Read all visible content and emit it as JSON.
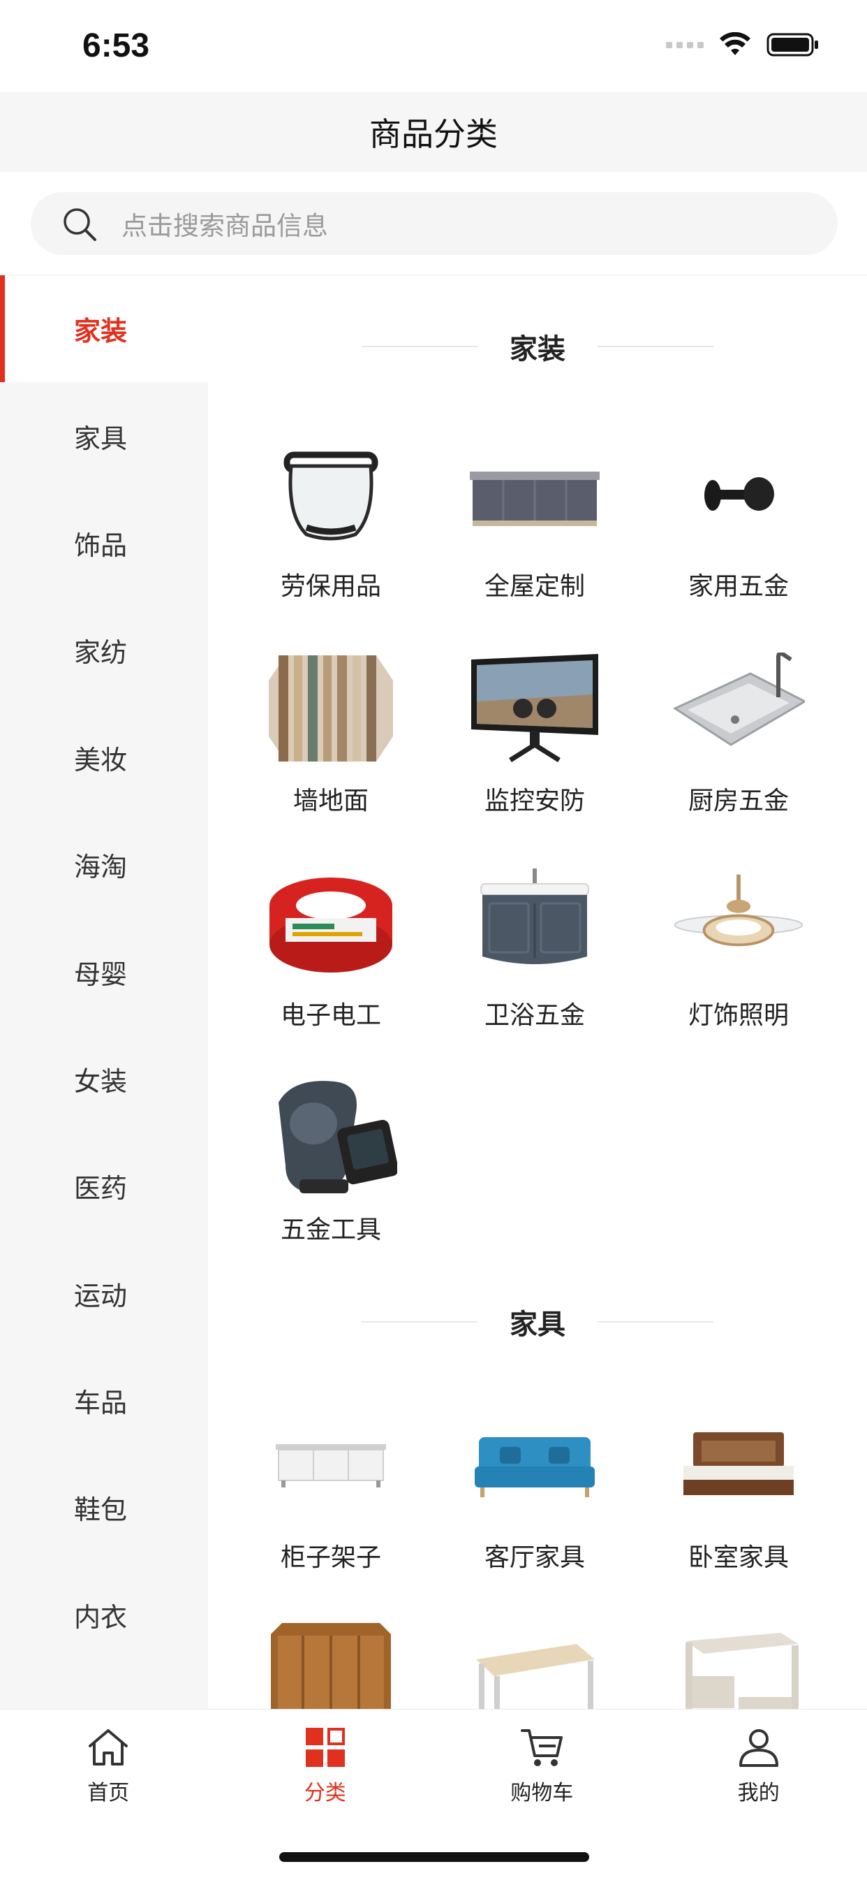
{
  "status_bar": {
    "time": "6:53"
  },
  "nav": {
    "title": "商品分类"
  },
  "search": {
    "placeholder": "点击搜索商品信息"
  },
  "sidebar": {
    "items": [
      {
        "label": "家装",
        "active": true
      },
      {
        "label": "家具"
      },
      {
        "label": "饰品"
      },
      {
        "label": "家纺"
      },
      {
        "label": "美妆"
      },
      {
        "label": "海淘"
      },
      {
        "label": "母婴"
      },
      {
        "label": "女装"
      },
      {
        "label": "医药"
      },
      {
        "label": "运动"
      },
      {
        "label": "车品"
      },
      {
        "label": "鞋包"
      },
      {
        "label": "内衣"
      }
    ]
  },
  "sections": [
    {
      "title": "家装",
      "items": [
        {
          "label": "劳保用品",
          "icon": "face-shield-icon"
        },
        {
          "label": "全屋定制",
          "icon": "cabinet-icon"
        },
        {
          "label": "家用五金",
          "icon": "wall-hook-icon"
        },
        {
          "label": "墙地面",
          "icon": "wall-panel-icon"
        },
        {
          "label": "监控安防",
          "icon": "monitor-icon"
        },
        {
          "label": "厨房五金",
          "icon": "sink-icon"
        },
        {
          "label": "电子电工",
          "icon": "wire-coil-icon"
        },
        {
          "label": "卫浴五金",
          "icon": "bathroom-vanity-icon"
        },
        {
          "label": "灯饰照明",
          "icon": "ceiling-fan-icon"
        },
        {
          "label": "五金工具",
          "icon": "power-tool-icon"
        }
      ]
    },
    {
      "title": "家具",
      "items": [
        {
          "label": "柜子架子",
          "icon": "kitchen-cabinet-icon"
        },
        {
          "label": "客厅家具",
          "icon": "sofa-icon"
        },
        {
          "label": "卧室家具",
          "icon": "bed-icon"
        },
        {
          "label": "",
          "icon": "wood-cabinet-icon"
        },
        {
          "label": "",
          "icon": "desk-icon"
        },
        {
          "label": "",
          "icon": "computer-desk-icon"
        }
      ]
    }
  ],
  "tabbar": {
    "tabs": [
      {
        "label": "首页",
        "icon": "home-icon"
      },
      {
        "label": "分类",
        "icon": "category-icon",
        "active": true
      },
      {
        "label": "购物车",
        "icon": "cart-icon"
      },
      {
        "label": "我的",
        "icon": "user-icon"
      }
    ]
  },
  "colors": {
    "accent": "#e0301e",
    "sidebar_bg": "#f6f6f6",
    "nav_bg": "#f6f6f6"
  }
}
